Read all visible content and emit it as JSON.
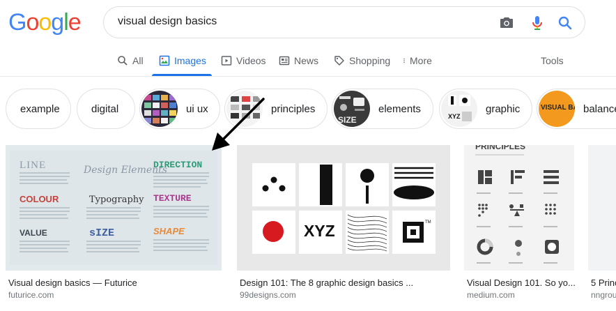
{
  "search": {
    "query": "visual design basics"
  },
  "tabs": [
    {
      "label": "All",
      "icon": "search-icon"
    },
    {
      "label": "Images",
      "icon": "images-icon"
    },
    {
      "label": "Videos",
      "icon": "video-icon"
    },
    {
      "label": "News",
      "icon": "news-icon"
    },
    {
      "label": "Shopping",
      "icon": "tag-icon"
    },
    {
      "label": "More",
      "icon": "more-vertical-icon"
    }
  ],
  "tools_label": "Tools",
  "chips": [
    {
      "label": "example"
    },
    {
      "label": "digital"
    },
    {
      "label": "ui ux"
    },
    {
      "label": "principles"
    },
    {
      "label": "elements"
    },
    {
      "label": "graphic"
    },
    {
      "label": "balance"
    }
  ],
  "results": [
    {
      "title": "Visual design basics — Futurice",
      "source": "futurice.com",
      "image_text": {
        "line": "LINE",
        "heading": "Design Elements",
        "direction": "DIRECTION",
        "colour": "COLOUR",
        "typography": "Typography",
        "texture": "TEXTURE",
        "value": "VALUE",
        "size": "sIZE",
        "shape": "SHAPE"
      }
    },
    {
      "title": "Design 101: The 8 graphic design basics ...",
      "source": "99designs.com",
      "image_text": {
        "xyz": "XYZ",
        "tm": "TM"
      }
    },
    {
      "title": "Visual Design 101. So yo...",
      "source": "medium.com",
      "image_text": {
        "principles": "PRINCIPLES"
      }
    },
    {
      "title": "5 Princ",
      "source": "nngrou"
    }
  ],
  "chip_thumb_text": {
    "elements": "SIZE",
    "graphic": "XYZ",
    "balance": "VISUAL BALANCE"
  },
  "colors": {
    "google_blue": "#4285F4",
    "google_red": "#EA4335",
    "google_yellow": "#FBBC05",
    "google_green": "#34A853",
    "active_tab": "#1a73e8"
  }
}
